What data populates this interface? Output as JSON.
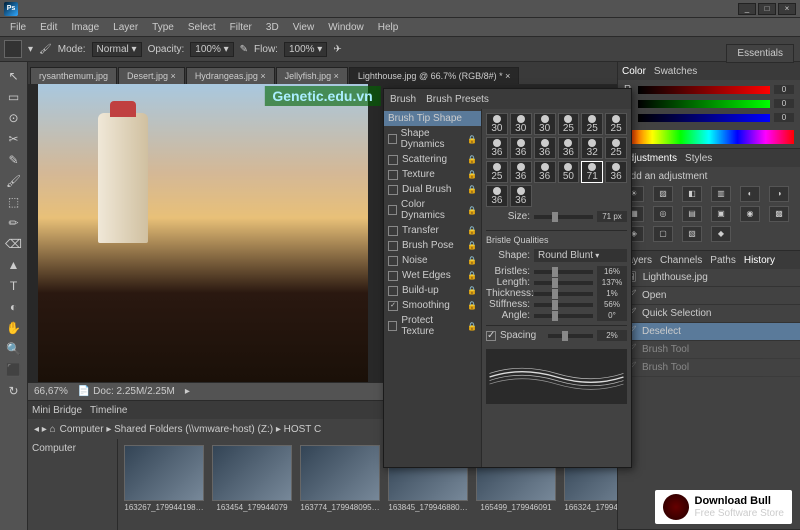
{
  "menubar": [
    "File",
    "Edit",
    "Image",
    "Layer",
    "Type",
    "Select",
    "Filter",
    "3D",
    "View",
    "Window",
    "Help"
  ],
  "options": {
    "mode_label": "Mode:",
    "mode_value": "Normal",
    "opacity_label": "Opacity:",
    "opacity_value": "100%",
    "flow_label": "Flow:",
    "flow_value": "100%"
  },
  "essentials": "Essentials",
  "tabs": [
    {
      "label": "rysanthemum.jpg",
      "active": false
    },
    {
      "label": "Desert.jpg ×",
      "active": false
    },
    {
      "label": "Hydrangeas.jpg ×",
      "active": false
    },
    {
      "label": "Jellyfish.jpg ×",
      "active": false
    },
    {
      "label": "Lighthouse.jpg @ 66.7% (RGB/8#) * ×",
      "active": true
    }
  ],
  "watermark": "Genetic.edu.vn",
  "status": {
    "zoom": "66,67%",
    "doc": "Doc: 2.25M/2.25M"
  },
  "minibridge": {
    "tabs": [
      "Mini Bridge",
      "Timeline"
    ],
    "side_label": "Computer",
    "path": [
      "Computer",
      "Shared Folders (\\\\vmware-host) (Z:)",
      "HOST C"
    ],
    "thumbs": [
      "163267_179944198…",
      "163454_179944079",
      "163774_179948095…",
      "163845_179946880…",
      "165499_179946091",
      "166324_179947128…"
    ]
  },
  "color": {
    "tabs": [
      "Color",
      "Swatches"
    ],
    "r": "0",
    "g": "0",
    "b": "0"
  },
  "adjustments": {
    "tabs": [
      "Adjustments",
      "Styles"
    ],
    "title": "Add an adjustment"
  },
  "layers": {
    "tabs": [
      "Layers",
      "Channels",
      "Paths",
      "History"
    ],
    "doc": "Lighthouse.jpg",
    "rows": [
      {
        "label": "Open",
        "sel": false
      },
      {
        "label": "Quick Selection",
        "sel": false
      },
      {
        "label": "Deselect",
        "sel": true
      },
      {
        "label": "Brush Tool",
        "sel": false,
        "dim": true
      },
      {
        "label": "Brush Tool",
        "sel": false,
        "dim": true
      }
    ]
  },
  "brush": {
    "tabs": [
      "Brush",
      "Brush Presets"
    ],
    "opts": [
      {
        "label": "Brush Tip Shape",
        "sel": true,
        "chk": false,
        "lock": false
      },
      {
        "label": "Shape Dynamics",
        "chk": false,
        "lock": true
      },
      {
        "label": "Scattering",
        "chk": false,
        "lock": true
      },
      {
        "label": "Texture",
        "chk": false,
        "lock": true
      },
      {
        "label": "Dual Brush",
        "chk": false,
        "lock": true
      },
      {
        "label": "Color Dynamics",
        "chk": false,
        "lock": true
      },
      {
        "label": "Transfer",
        "chk": false,
        "lock": true
      },
      {
        "label": "Brush Pose",
        "chk": false,
        "lock": true
      },
      {
        "label": "Noise",
        "chk": false,
        "lock": true
      },
      {
        "label": "Wet Edges",
        "chk": false,
        "lock": true
      },
      {
        "label": "Build-up",
        "chk": false,
        "lock": true
      },
      {
        "label": "Smoothing",
        "chk": true,
        "lock": true
      },
      {
        "label": "Protect Texture",
        "chk": false,
        "lock": true
      }
    ],
    "tips": [
      "30",
      "30",
      "30",
      "25",
      "25",
      "25",
      "36",
      "36",
      "36",
      "36",
      "32",
      "25",
      "25",
      "36",
      "36",
      "50",
      "71",
      "36",
      "36",
      "36"
    ],
    "size_label": "Size:",
    "size_value": "71 px",
    "section": "Bristle Qualities",
    "shape_label": "Shape:",
    "shape_value": "Round Blunt",
    "props": [
      {
        "label": "Bristles:",
        "value": "16%"
      },
      {
        "label": "Length:",
        "value": "137%"
      },
      {
        "label": "Thickness:",
        "value": "1%"
      },
      {
        "label": "Stiffness:",
        "value": "56%"
      },
      {
        "label": "Angle:",
        "value": "0°"
      }
    ],
    "spacing_label": "Spacing",
    "spacing_value": "2%"
  },
  "badge": {
    "title": "Download Bull",
    "sub": "Free Software Store"
  }
}
